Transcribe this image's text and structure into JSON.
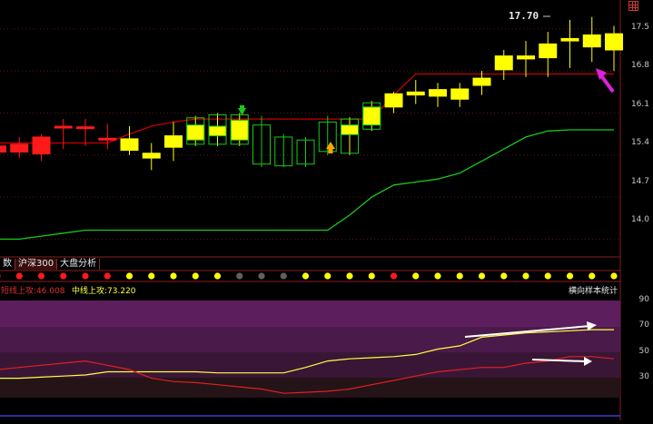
{
  "tabs": [
    {
      "label": "数",
      "active": false
    },
    {
      "label": "沪深300",
      "active": true
    },
    {
      "label": "大盘分析",
      "active": false
    }
  ],
  "price_axis": [
    "17.5",
    "16.8",
    "16.1",
    "15.4",
    "14.7",
    "14.0"
  ],
  "indicator_axis": [
    "90",
    "70",
    "50",
    "30"
  ],
  "peak_label": "17.70",
  "indicator": {
    "short_label": "短线上攻:46.008",
    "mid_label": "中线上攻:73.220",
    "title": "横向样本统计"
  },
  "colors": {
    "up": "#ff1a1a",
    "down_yellow": "#ffff00",
    "hollow": "#19c819",
    "red_line": "#c80000",
    "green_line": "#19c819",
    "magenta_arrow": "#e020e0"
  },
  "chart_data": {
    "type": "candlestick",
    "ylim": [
      13.9,
      17.8
    ],
    "candles": [
      {
        "o": 15.45,
        "h": 15.65,
        "l": 15.25,
        "c": 15.55,
        "color": "red"
      },
      {
        "o": 15.45,
        "h": 15.7,
        "l": 15.35,
        "c": 15.58,
        "color": "red"
      },
      {
        "o": 15.42,
        "h": 15.75,
        "l": 15.3,
        "c": 15.7,
        "color": "red"
      },
      {
        "o": 15.88,
        "h": 16.0,
        "l": 15.5,
        "c": 15.85,
        "color": "red"
      },
      {
        "o": 15.87,
        "h": 16.0,
        "l": 15.55,
        "c": 15.84,
        "color": "red"
      },
      {
        "o": 15.68,
        "h": 15.92,
        "l": 15.5,
        "c": 15.65,
        "color": "red"
      },
      {
        "o": 15.67,
        "h": 15.88,
        "l": 15.4,
        "c": 15.48,
        "color": "yellow"
      },
      {
        "o": 15.43,
        "h": 15.6,
        "l": 15.15,
        "c": 15.35,
        "color": "yellow"
      },
      {
        "o": 15.72,
        "h": 15.95,
        "l": 15.3,
        "c": 15.53,
        "color": "yellow"
      },
      {
        "o": 15.9,
        "h": 16.05,
        "l": 15.55,
        "c": 15.65,
        "color": "yellow_hollow"
      },
      {
        "o": 15.88,
        "h": 16.1,
        "l": 15.55,
        "c": 15.72,
        "color": "yellow_hollow"
      },
      {
        "o": 15.98,
        "h": 16.1,
        "l": 15.55,
        "c": 15.65,
        "color": "yellow_hollow"
      },
      {
        "o": 15.9,
        "h": 16.05,
        "l": 15.2,
        "c": 15.25,
        "color": "green"
      },
      {
        "o": 15.7,
        "h": 15.75,
        "l": 15.2,
        "c": 15.22,
        "color": "green"
      },
      {
        "o": 15.65,
        "h": 15.7,
        "l": 15.2,
        "c": 15.25,
        "color": "green"
      },
      {
        "o": 15.95,
        "h": 16.05,
        "l": 15.4,
        "c": 15.46,
        "color": "green"
      },
      {
        "o": 15.74,
        "h": 16.03,
        "l": 15.4,
        "c": 15.9,
        "color": "yellow_hollow"
      },
      {
        "o": 15.9,
        "h": 16.3,
        "l": 15.8,
        "c": 16.2,
        "color": "yellow_hollow"
      },
      {
        "o": 16.2,
        "h": 16.45,
        "l": 16.1,
        "c": 16.42,
        "color": "yellow"
      },
      {
        "o": 16.4,
        "h": 16.65,
        "l": 16.25,
        "c": 16.45,
        "color": "yellow"
      },
      {
        "o": 16.38,
        "h": 16.6,
        "l": 16.2,
        "c": 16.49,
        "color": "yellow"
      },
      {
        "o": 16.33,
        "h": 16.6,
        "l": 16.2,
        "c": 16.5,
        "color": "yellow"
      },
      {
        "o": 16.56,
        "h": 16.8,
        "l": 16.4,
        "c": 16.68,
        "color": "yellow"
      },
      {
        "o": 16.82,
        "h": 17.15,
        "l": 16.65,
        "c": 17.05,
        "color": "yellow"
      },
      {
        "o": 17.0,
        "h": 17.3,
        "l": 16.7,
        "c": 17.05,
        "color": "yellow"
      },
      {
        "o": 17.02,
        "h": 17.45,
        "l": 16.7,
        "c": 17.25,
        "color": "yellow"
      },
      {
        "o": 17.3,
        "h": 17.65,
        "l": 16.85,
        "c": 17.34,
        "color": "yellow"
      },
      {
        "o": 17.2,
        "h": 17.7,
        "l": 16.95,
        "c": 17.4,
        "color": "yellow"
      },
      {
        "o": 17.15,
        "h": 17.55,
        "l": 16.8,
        "c": 17.42,
        "color": "yellow"
      }
    ],
    "red_line": [
      15.6,
      15.6,
      15.6,
      15.6,
      15.6,
      15.6,
      15.75,
      15.88,
      15.95,
      16.0,
      16.0,
      16.0,
      16.0,
      16.0,
      16.0,
      16.0,
      16.0,
      16.0,
      16.4,
      16.75,
      16.75,
      16.75,
      16.75,
      16.75,
      16.75,
      16.75,
      16.75,
      16.75,
      16.75
    ],
    "green_line": [
      14.0,
      14.0,
      14.05,
      14.1,
      14.15,
      14.15,
      14.15,
      14.15,
      14.15,
      14.15,
      14.15,
      14.15,
      14.15,
      14.15,
      14.15,
      14.15,
      14.4,
      14.7,
      14.9,
      14.95,
      15.0,
      15.1,
      15.3,
      15.5,
      15.7,
      15.8,
      15.82,
      15.82,
      15.82
    ],
    "dots": [
      "red",
      "red",
      "red",
      "red",
      "red",
      "red",
      "yellow",
      "yellow",
      "yellow",
      "yellow",
      "yellow",
      "gray",
      "gray",
      "gray",
      "yellow",
      "yellow",
      "yellow",
      "yellow",
      "red",
      "yellow",
      "yellow",
      "yellow",
      "yellow",
      "yellow",
      "yellow",
      "yellow",
      "yellow",
      "yellow",
      "yellow"
    ],
    "indicator_ylim": [
      10,
      100
    ],
    "short_line": [
      36,
      38,
      40,
      42,
      44,
      40,
      36,
      28,
      25,
      24,
      22,
      20,
      18,
      14,
      15,
      16,
      18,
      22,
      26,
      30,
      34,
      36,
      38,
      38,
      42,
      44,
      48,
      48,
      46
    ],
    "mid_line": [
      28,
      28,
      29,
      30,
      31,
      34,
      34,
      34,
      34,
      34,
      33,
      33,
      33,
      33,
      38,
      44,
      46,
      47,
      48,
      50,
      55,
      58,
      66,
      68,
      70,
      71,
      72,
      73,
      73
    ]
  }
}
